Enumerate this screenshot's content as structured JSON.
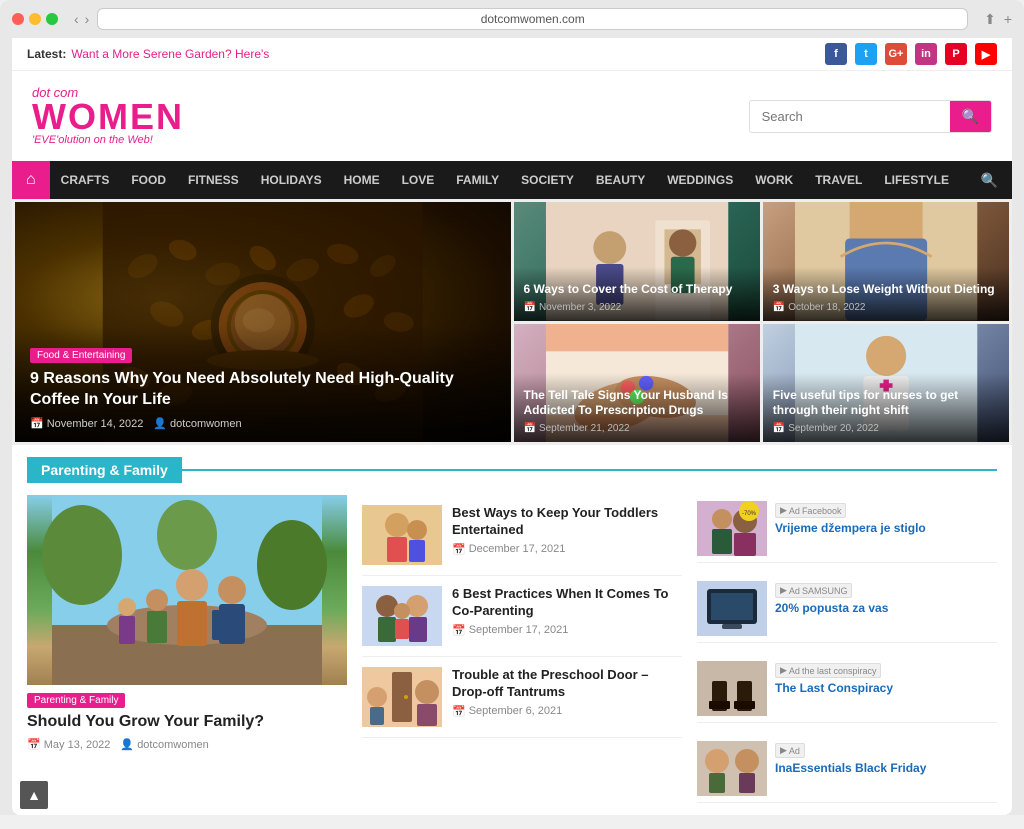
{
  "browser": {
    "url": "dotcomwomen.com"
  },
  "topbar": {
    "latest_label": "Latest:",
    "latest_text": "Want a More Serene Garden? Here's",
    "social": [
      "f",
      "t",
      "G+",
      "in",
      "P",
      "▶"
    ]
  },
  "header": {
    "logo_dotcom": "dot com",
    "logo_women": "WOMEN",
    "logo_tagline": "'EVE'olution on the Web!",
    "search_placeholder": "Search"
  },
  "nav": {
    "home_icon": "⌂",
    "items": [
      "CRAFTS",
      "FOOD",
      "FITNESS",
      "HOLIDAYS",
      "HOME",
      "LOVE",
      "FAMILY",
      "SOCIETY",
      "BEAUTY",
      "WEDDINGS",
      "WORK",
      "TRAVEL",
      "LIFESTYLE"
    ]
  },
  "hero": {
    "main": {
      "category": "Food & Entertaining",
      "title": "9 Reasons Why You Need Absolutely Need High-Quality Coffee In Your Life",
      "date": "November 14, 2022",
      "author": "dotcomwomen"
    },
    "cards": [
      {
        "title": "6 Ways to Cover the Cost of Therapy",
        "date": "November 3, 2022"
      },
      {
        "title": "3 Ways to Lose Weight Without Dieting",
        "date": "October 18, 2022"
      },
      {
        "title": "The Tell Tale Signs Your Husband Is Addicted To Prescription Drugs",
        "date": "September 21, 2022"
      },
      {
        "title": "Five useful tips for nurses to get through their night shift",
        "date": "September 20, 2022"
      }
    ]
  },
  "parenting_section": {
    "title": "Parenting & Family",
    "main_article": {
      "category": "Parenting & Family",
      "title": "Should You Grow Your Family?",
      "date": "May 13, 2022",
      "author": "dotcomwomen"
    },
    "articles": [
      {
        "title": "Best Ways to Keep Your Toddlers Entertained",
        "date": "December 17, 2021"
      },
      {
        "title": "6 Best Practices When It Comes To Co-Parenting",
        "date": "September 17, 2021"
      },
      {
        "title": "Trouble at the Preschool Door – Drop-off Tantrums",
        "date": "September 6, 2021"
      }
    ]
  },
  "ads": [
    {
      "title": "Vrijeme džempera je stiglo",
      "source": "Facebook",
      "badge": "Ad"
    },
    {
      "title": "20% popusta za vas",
      "source": "SAMSUNG",
      "badge": "Ad"
    },
    {
      "title": "The Last Conspiracy",
      "source": "the last conspiracy",
      "badge": "Ad"
    },
    {
      "title": "InaEssentials Black Friday",
      "source": "",
      "badge": "Ad"
    }
  ],
  "icons": {
    "calendar": "📅",
    "user": "👤",
    "search": "🔍",
    "home": "⌂",
    "arrow_up": "▲"
  }
}
